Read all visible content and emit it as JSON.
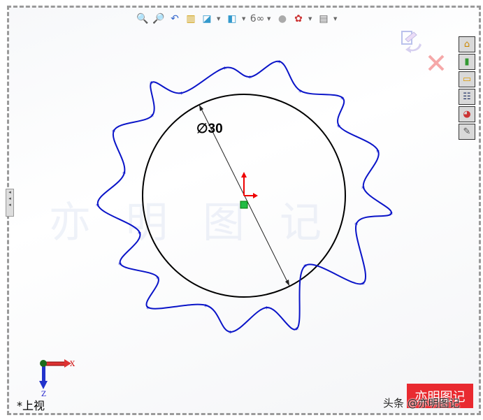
{
  "toolbar": {
    "items": [
      {
        "name": "zoom-to-fit",
        "glyph": "🔍"
      },
      {
        "name": "zoom-to-area",
        "glyph": "🔎"
      },
      {
        "name": "previous-view",
        "glyph": "↶"
      },
      {
        "name": "section-view",
        "glyph": "▥"
      },
      {
        "name": "view-orientation",
        "glyph": "◪",
        "dropdown": true
      },
      {
        "name": "display-style",
        "glyph": "◧",
        "dropdown": true
      },
      {
        "name": "hide-show-items",
        "glyph": "6∞",
        "dropdown": true
      },
      {
        "name": "edit-appearance",
        "glyph": "●"
      },
      {
        "name": "apply-scene",
        "glyph": "✿",
        "dropdown": true
      },
      {
        "name": "view-settings",
        "glyph": "▤",
        "dropdown": true
      }
    ]
  },
  "taskpane": {
    "items": [
      {
        "name": "solidworks-resources",
        "glyph": "⌂"
      },
      {
        "name": "design-library",
        "glyph": "▮"
      },
      {
        "name": "file-explorer",
        "glyph": "▭"
      },
      {
        "name": "view-palette",
        "glyph": "☷"
      },
      {
        "name": "appearances-scenes",
        "glyph": "◕"
      },
      {
        "name": "custom-properties",
        "glyph": "✎"
      }
    ]
  },
  "dimension": "∅30",
  "view_name": "*上视",
  "triad": {
    "x": "X",
    "z": "Z"
  },
  "watermark": {
    "credit": "头条 @亦明图记",
    "stamp": "亦明图记",
    "faint": "亦明图记"
  },
  "colors": {
    "spline": "#0a14c8",
    "circle": "#000000",
    "origin": "#e00000"
  }
}
